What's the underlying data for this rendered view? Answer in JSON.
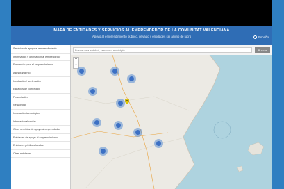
{
  "header": {
    "title": "MAPA DE ENTIDADES Y SERVICIOS AL EMPRENDEDOR DE LA COMUNITAT VALENCIANA",
    "subtitle": "Apoyo al emprendimiento público, privado y entidades sin ánimo de lucro",
    "language_label": "Español"
  },
  "sidebar": {
    "items": [
      {
        "label": "Servicios de apoyo al emprendimiento"
      },
      {
        "label": "Información y orientación al emprendedor"
      },
      {
        "label": "Formación para el emprendimiento"
      },
      {
        "label": "Asesoramiento"
      },
      {
        "label": "Incubación / aceleración"
      },
      {
        "label": "Espacios de coworking"
      },
      {
        "label": "Financiación"
      },
      {
        "label": "Networking"
      },
      {
        "label": "Innovación tecnológica"
      },
      {
        "label": "Internacionalización"
      },
      {
        "label": "Otros servicios de apoyo al emprendedor"
      },
      {
        "label": "Entidades de apoyo al emprendimiento"
      },
      {
        "label": "Entidades públicas locales"
      },
      {
        "label": "Otras entidades"
      }
    ]
  },
  "search": {
    "placeholder": "Buscar una entidad, servicio o municipio...",
    "button_label": "Buscar"
  },
  "map": {
    "zoom_in": "+",
    "zoom_out": "−",
    "colors": {
      "cluster": "#3c70c4",
      "pin": "#e0c800"
    }
  }
}
